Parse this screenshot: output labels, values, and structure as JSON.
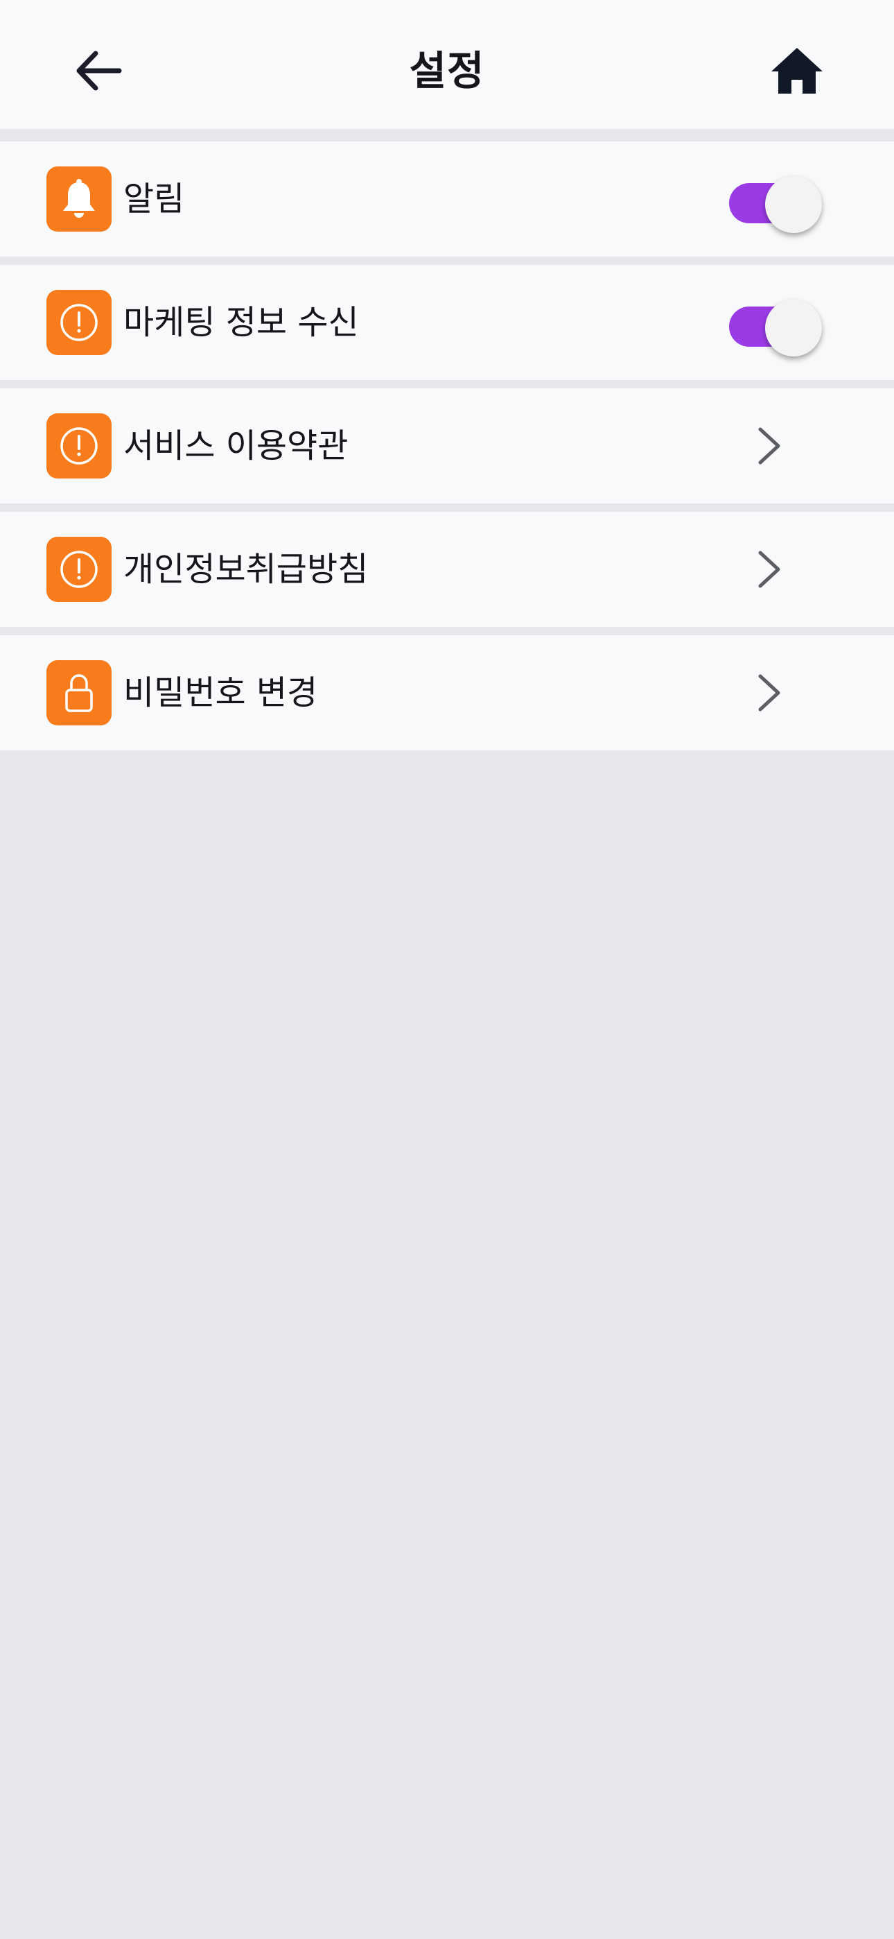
{
  "header": {
    "title": "설정",
    "back_icon": "arrow-left-icon",
    "home_icon": "home-icon"
  },
  "colors": {
    "accent_orange": "#f87c1c",
    "toggle_purple": "#9b3be6",
    "background": "#e6e7eb",
    "surface": "#f8f9fb"
  },
  "menu": {
    "items": [
      {
        "label": "알림",
        "icon": "bell-icon",
        "control": "toggle",
        "on": true
      },
      {
        "label": "마케팅 정보 수신",
        "icon": "alert-circle-icon",
        "control": "toggle",
        "on": true
      },
      {
        "label": "서비스 이용약관",
        "icon": "alert-circle-icon",
        "control": "chevron"
      },
      {
        "label": "개인정보취급방침",
        "icon": "alert-circle-icon",
        "control": "chevron"
      },
      {
        "label": "비밀번호 변경",
        "icon": "lock-icon",
        "control": "chevron"
      }
    ]
  }
}
